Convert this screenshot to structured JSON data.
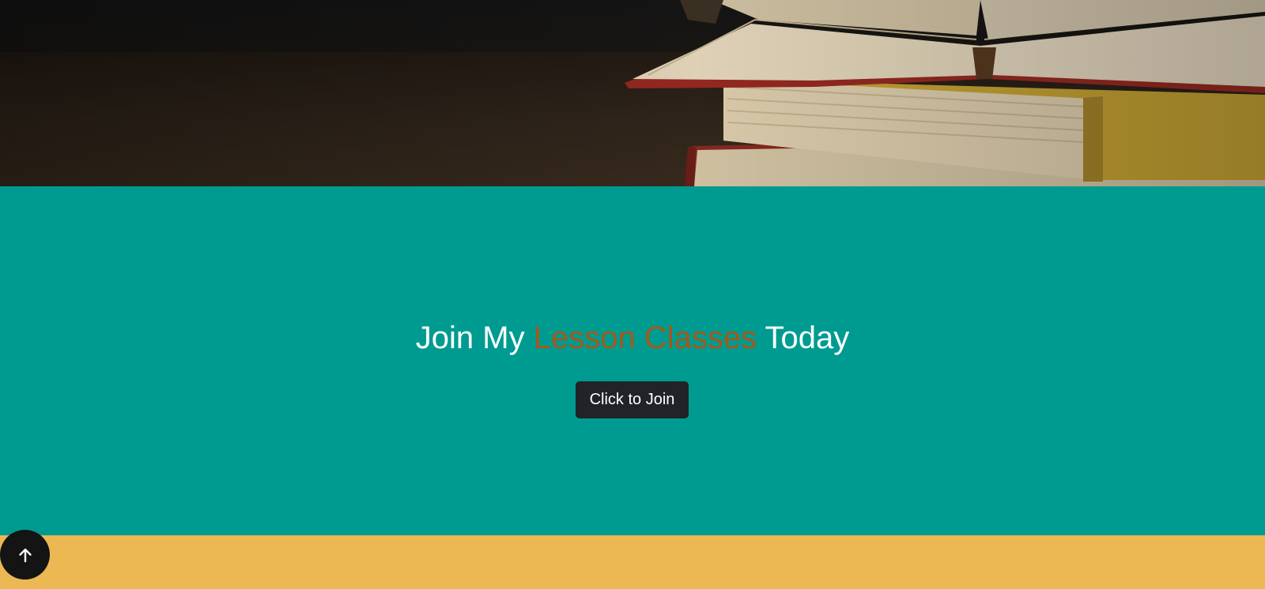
{
  "hero": {
    "image": "stacked-books-image"
  },
  "join_section": {
    "heading_prefix": "Join My",
    "heading_accent": "Lesson Classes",
    "heading_suffix": "Today",
    "button_label": "Click to Join"
  },
  "scroll_top": {
    "icon": "arrow-up-icon"
  },
  "colors": {
    "join_background": "#009b90",
    "heading_accent": "#a4581b",
    "button_background": "#212328",
    "footer_band": "#ecb853",
    "scroll_top_background": "#141414"
  }
}
